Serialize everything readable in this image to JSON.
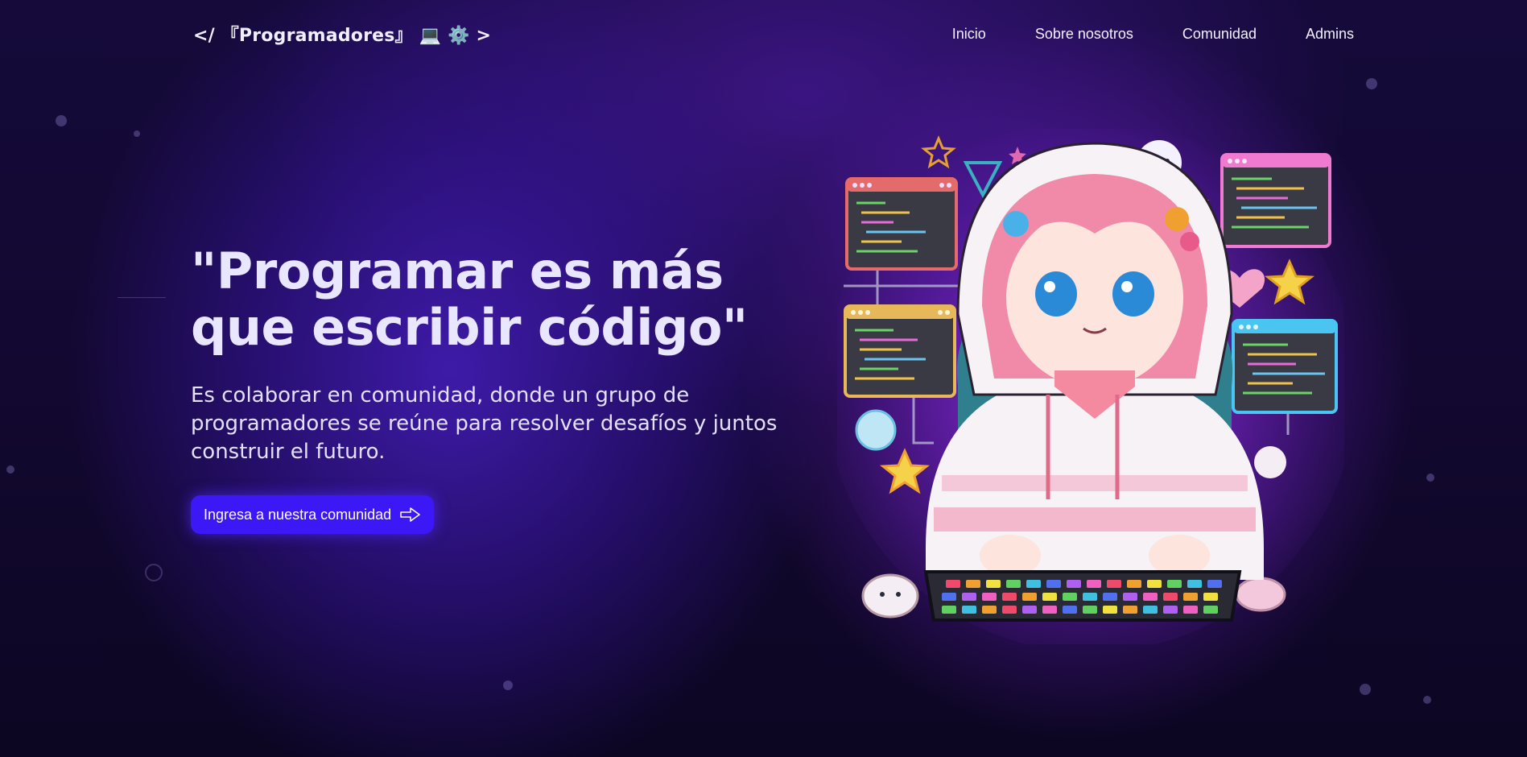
{
  "header": {
    "brand": "</ 『Programadores』 💻 ⚙️ >",
    "nav": [
      {
        "label": "Inicio"
      },
      {
        "label": "Sobre nosotros"
      },
      {
        "label": "Comunidad"
      },
      {
        "label": "Admins"
      }
    ]
  },
  "hero": {
    "title": "\"Programar es más que escribir código\"",
    "subtitle": "Es colaborar en comunidad, donde un grupo de programadores se reúne para resolver desafíos y juntos construir el futuro.",
    "cta_label": "Ingresa a nuestra comunidad",
    "cta_icon": "arrow-right-icon"
  },
  "illustration": {
    "subject": "anime-programmer-girl-illustration"
  },
  "colors": {
    "accent": "#3b18f5",
    "background": "#150a3a",
    "glow": "#8c28e6",
    "text": "#e9e6ff"
  }
}
